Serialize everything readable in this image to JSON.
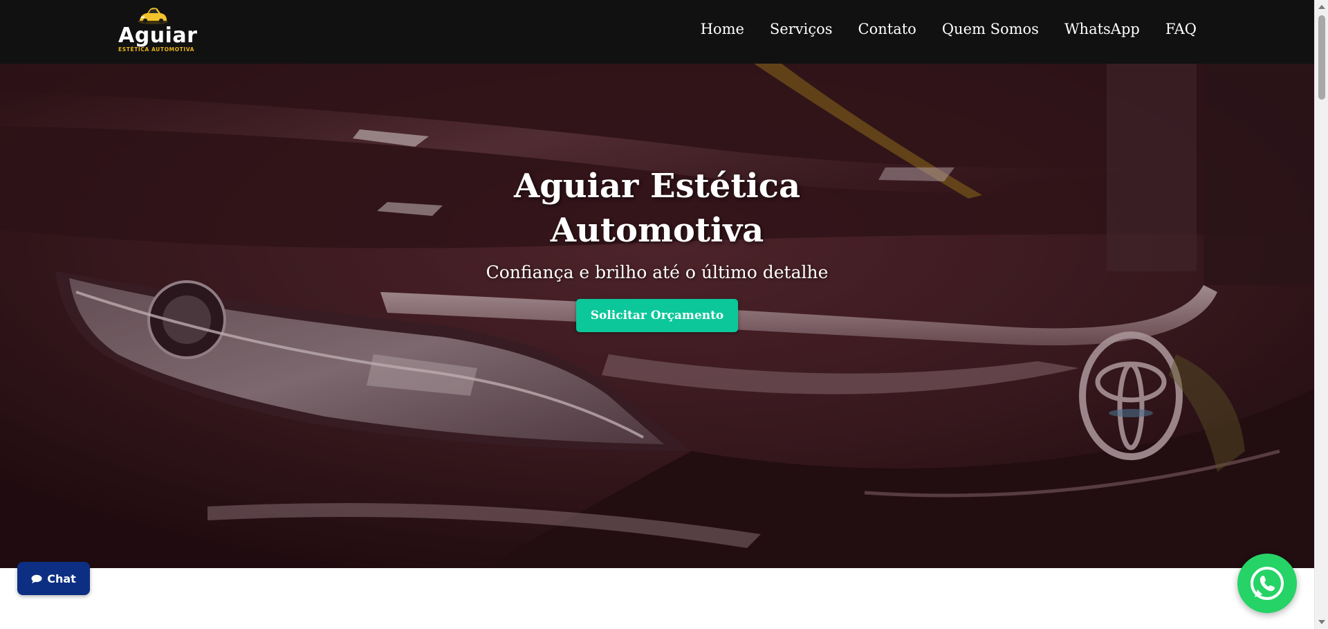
{
  "brand": {
    "name": "Aguiar",
    "tagline": "ESTÉTICA AUTOMOTIVA",
    "accent_color": "#e8b21c",
    "logo_icon": "car-icon"
  },
  "nav": {
    "items": [
      {
        "label": "Home"
      },
      {
        "label": "Serviços"
      },
      {
        "label": "Contato"
      },
      {
        "label": "Quem Somos"
      },
      {
        "label": "WhatsApp"
      },
      {
        "label": "FAQ"
      }
    ]
  },
  "hero": {
    "title": "Aguiar Estética Automotiva",
    "subtitle": "Confiança e brilho até o último detalhe",
    "cta_label": "Solicitar Orçamento",
    "cta_color": "#0cc79a",
    "background_icon": "car-front-photo"
  },
  "chat": {
    "label": "Chat",
    "icon": "speech-bubble-icon",
    "color": "#0d2f83"
  },
  "whatsapp_float": {
    "icon": "whatsapp-icon",
    "color": "#25d366"
  },
  "colors": {
    "navbar": "#111111",
    "hero_overlay": "#2b1115"
  }
}
